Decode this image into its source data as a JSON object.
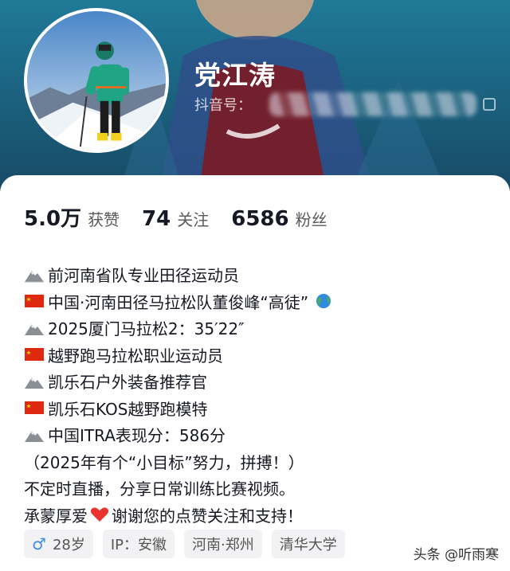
{
  "profile": {
    "display_name": "党江涛",
    "douyin_id_label": "抖音号："
  },
  "stats": [
    {
      "value": "5.0万",
      "label": "获赞"
    },
    {
      "value": "74",
      "label": "关注"
    },
    {
      "value": "6586",
      "label": "粉丝"
    }
  ],
  "bio": [
    {
      "icon": "mountain-icon",
      "text": "前河南省队专业田径运动员"
    },
    {
      "icon": "china-flag-icon",
      "text": "中国·河南田径马拉松队董俊峰“高徒”",
      "trail_icon": "globe-icon"
    },
    {
      "icon": "mountain-icon",
      "text": "2025厦门马拉松2：35′22″"
    },
    {
      "icon": "china-flag-icon",
      "text": "越野跑马拉松职业运动员"
    },
    {
      "icon": "mountain-icon",
      "text": "凯乐石户外装备推荐官"
    },
    {
      "icon": "china-flag-icon",
      "text": "凯乐石KOS越野跑模特"
    },
    {
      "icon": "mountain-icon",
      "text": "中国ITRA表现分：586分"
    },
    {
      "text": "（2025年有个“小目标”努力，拼搏！）"
    },
    {
      "text": "不定时直播，分享日常训练比赛视频。"
    },
    {
      "text_before": "承蒙厚爱",
      "icon": "heart-icon",
      "text_after": "谢谢您的点赞关注和支持！"
    }
  ],
  "tags": {
    "age": "28岁",
    "ip": "IP：安徽",
    "location": "河南·郑州",
    "school": "清华大学"
  },
  "watermark": "头条 @听雨寒",
  "colors": {
    "header_bg": "#1a5f7d",
    "gender": "#3b8ee8",
    "flag_red": "#de2910",
    "heart": "#e8332e"
  }
}
